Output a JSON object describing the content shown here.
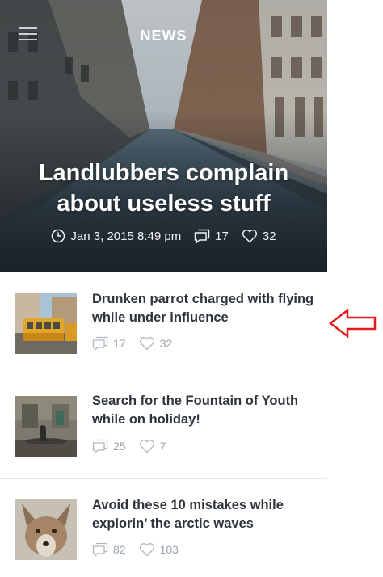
{
  "header": {
    "title": "NEWS",
    "menu_icon": "hamburger-menu-icon"
  },
  "hero": {
    "headline": "Landlubbers complain about useless stuff",
    "date": "Jan 3, 2015 8:49 pm",
    "comments": "17",
    "likes": "32"
  },
  "articles": [
    {
      "title": "Drunken parrot charged with flying while under influence",
      "comments": "17",
      "likes": "32",
      "thumb": "tram-photo"
    },
    {
      "title": "Search for the Fountain of Youth while on holiday!",
      "comments": "25",
      "likes": "7",
      "thumb": "fountain-photo"
    },
    {
      "title": "Avoid these 10 mistakes while explorin’ the arctic waves",
      "comments": "82",
      "likes": "103",
      "thumb": "coyote-photo"
    }
  ],
  "colors": {
    "text_dark": "#2d343c",
    "meta_gray": "#9aa3ab",
    "annotation_red": "#e01b1b"
  }
}
